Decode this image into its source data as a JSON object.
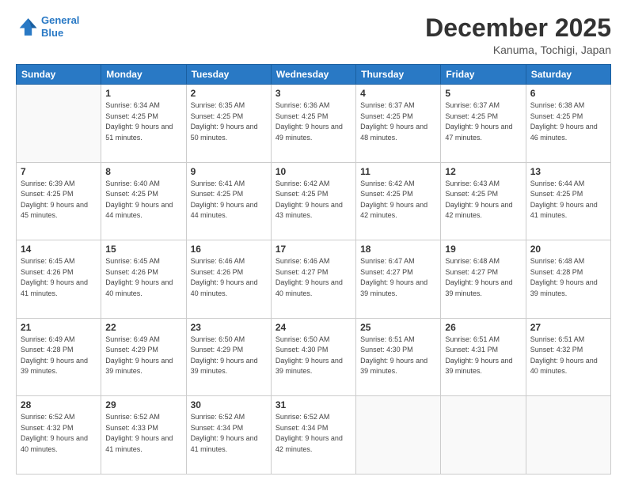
{
  "header": {
    "logo_line1": "General",
    "logo_line2": "Blue",
    "month": "December 2025",
    "location": "Kanuma, Tochigi, Japan"
  },
  "weekdays": [
    "Sunday",
    "Monday",
    "Tuesday",
    "Wednesday",
    "Thursday",
    "Friday",
    "Saturday"
  ],
  "weeks": [
    [
      {
        "day": "",
        "sunrise": "",
        "sunset": "",
        "daylight": ""
      },
      {
        "day": "1",
        "sunrise": "Sunrise: 6:34 AM",
        "sunset": "Sunset: 4:25 PM",
        "daylight": "Daylight: 9 hours and 51 minutes."
      },
      {
        "day": "2",
        "sunrise": "Sunrise: 6:35 AM",
        "sunset": "Sunset: 4:25 PM",
        "daylight": "Daylight: 9 hours and 50 minutes."
      },
      {
        "day": "3",
        "sunrise": "Sunrise: 6:36 AM",
        "sunset": "Sunset: 4:25 PM",
        "daylight": "Daylight: 9 hours and 49 minutes."
      },
      {
        "day": "4",
        "sunrise": "Sunrise: 6:37 AM",
        "sunset": "Sunset: 4:25 PM",
        "daylight": "Daylight: 9 hours and 48 minutes."
      },
      {
        "day": "5",
        "sunrise": "Sunrise: 6:37 AM",
        "sunset": "Sunset: 4:25 PM",
        "daylight": "Daylight: 9 hours and 47 minutes."
      },
      {
        "day": "6",
        "sunrise": "Sunrise: 6:38 AM",
        "sunset": "Sunset: 4:25 PM",
        "daylight": "Daylight: 9 hours and 46 minutes."
      }
    ],
    [
      {
        "day": "7",
        "sunrise": "Sunrise: 6:39 AM",
        "sunset": "Sunset: 4:25 PM",
        "daylight": "Daylight: 9 hours and 45 minutes."
      },
      {
        "day": "8",
        "sunrise": "Sunrise: 6:40 AM",
        "sunset": "Sunset: 4:25 PM",
        "daylight": "Daylight: 9 hours and 44 minutes."
      },
      {
        "day": "9",
        "sunrise": "Sunrise: 6:41 AM",
        "sunset": "Sunset: 4:25 PM",
        "daylight": "Daylight: 9 hours and 44 minutes."
      },
      {
        "day": "10",
        "sunrise": "Sunrise: 6:42 AM",
        "sunset": "Sunset: 4:25 PM",
        "daylight": "Daylight: 9 hours and 43 minutes."
      },
      {
        "day": "11",
        "sunrise": "Sunrise: 6:42 AM",
        "sunset": "Sunset: 4:25 PM",
        "daylight": "Daylight: 9 hours and 42 minutes."
      },
      {
        "day": "12",
        "sunrise": "Sunrise: 6:43 AM",
        "sunset": "Sunset: 4:25 PM",
        "daylight": "Daylight: 9 hours and 42 minutes."
      },
      {
        "day": "13",
        "sunrise": "Sunrise: 6:44 AM",
        "sunset": "Sunset: 4:25 PM",
        "daylight": "Daylight: 9 hours and 41 minutes."
      }
    ],
    [
      {
        "day": "14",
        "sunrise": "Sunrise: 6:45 AM",
        "sunset": "Sunset: 4:26 PM",
        "daylight": "Daylight: 9 hours and 41 minutes."
      },
      {
        "day": "15",
        "sunrise": "Sunrise: 6:45 AM",
        "sunset": "Sunset: 4:26 PM",
        "daylight": "Daylight: 9 hours and 40 minutes."
      },
      {
        "day": "16",
        "sunrise": "Sunrise: 6:46 AM",
        "sunset": "Sunset: 4:26 PM",
        "daylight": "Daylight: 9 hours and 40 minutes."
      },
      {
        "day": "17",
        "sunrise": "Sunrise: 6:46 AM",
        "sunset": "Sunset: 4:27 PM",
        "daylight": "Daylight: 9 hours and 40 minutes."
      },
      {
        "day": "18",
        "sunrise": "Sunrise: 6:47 AM",
        "sunset": "Sunset: 4:27 PM",
        "daylight": "Daylight: 9 hours and 39 minutes."
      },
      {
        "day": "19",
        "sunrise": "Sunrise: 6:48 AM",
        "sunset": "Sunset: 4:27 PM",
        "daylight": "Daylight: 9 hours and 39 minutes."
      },
      {
        "day": "20",
        "sunrise": "Sunrise: 6:48 AM",
        "sunset": "Sunset: 4:28 PM",
        "daylight": "Daylight: 9 hours and 39 minutes."
      }
    ],
    [
      {
        "day": "21",
        "sunrise": "Sunrise: 6:49 AM",
        "sunset": "Sunset: 4:28 PM",
        "daylight": "Daylight: 9 hours and 39 minutes."
      },
      {
        "day": "22",
        "sunrise": "Sunrise: 6:49 AM",
        "sunset": "Sunset: 4:29 PM",
        "daylight": "Daylight: 9 hours and 39 minutes."
      },
      {
        "day": "23",
        "sunrise": "Sunrise: 6:50 AM",
        "sunset": "Sunset: 4:29 PM",
        "daylight": "Daylight: 9 hours and 39 minutes."
      },
      {
        "day": "24",
        "sunrise": "Sunrise: 6:50 AM",
        "sunset": "Sunset: 4:30 PM",
        "daylight": "Daylight: 9 hours and 39 minutes."
      },
      {
        "day": "25",
        "sunrise": "Sunrise: 6:51 AM",
        "sunset": "Sunset: 4:30 PM",
        "daylight": "Daylight: 9 hours and 39 minutes."
      },
      {
        "day": "26",
        "sunrise": "Sunrise: 6:51 AM",
        "sunset": "Sunset: 4:31 PM",
        "daylight": "Daylight: 9 hours and 39 minutes."
      },
      {
        "day": "27",
        "sunrise": "Sunrise: 6:51 AM",
        "sunset": "Sunset: 4:32 PM",
        "daylight": "Daylight: 9 hours and 40 minutes."
      }
    ],
    [
      {
        "day": "28",
        "sunrise": "Sunrise: 6:52 AM",
        "sunset": "Sunset: 4:32 PM",
        "daylight": "Daylight: 9 hours and 40 minutes."
      },
      {
        "day": "29",
        "sunrise": "Sunrise: 6:52 AM",
        "sunset": "Sunset: 4:33 PM",
        "daylight": "Daylight: 9 hours and 41 minutes."
      },
      {
        "day": "30",
        "sunrise": "Sunrise: 6:52 AM",
        "sunset": "Sunset: 4:34 PM",
        "daylight": "Daylight: 9 hours and 41 minutes."
      },
      {
        "day": "31",
        "sunrise": "Sunrise: 6:52 AM",
        "sunset": "Sunset: 4:34 PM",
        "daylight": "Daylight: 9 hours and 42 minutes."
      },
      {
        "day": "",
        "sunrise": "",
        "sunset": "",
        "daylight": ""
      },
      {
        "day": "",
        "sunrise": "",
        "sunset": "",
        "daylight": ""
      },
      {
        "day": "",
        "sunrise": "",
        "sunset": "",
        "daylight": ""
      }
    ]
  ]
}
